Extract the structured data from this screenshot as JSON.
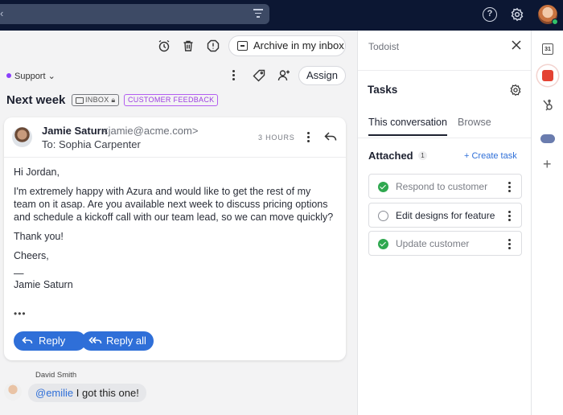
{
  "toolbar": {
    "archive_label": "Archive in my inbox"
  },
  "meta": {
    "team": "Support",
    "team_color": "#8a3ffc",
    "assign_label": "Assign"
  },
  "conversation": {
    "subject": "Next week",
    "tag_inbox": "INBOX",
    "tag_feedback": "CUSTOMER FEEDBACK"
  },
  "email": {
    "sender_name": "Jamie Saturn",
    "sender_email": "<jamie@acme.com>",
    "to_line": "To: Sophia Carpenter",
    "time": "3 HOURS",
    "greeting": "Hi Jordan,",
    "body": "I'm extremely happy with Azura and would like to get the rest of my team on it asap. Are you available next week to discuss pricing options and schedule a kickoff call with our team lead, so we can move quickly?",
    "thanks": "Thank you!",
    "closing": "Cheers,",
    "sig_dash": "—",
    "signature": "Jamie Saturn",
    "more": "•••",
    "reply_label": "Reply",
    "reply_all_label": "Reply all"
  },
  "comment": {
    "author": "David Smith",
    "mention": "@emilie",
    "text": " I got this one!"
  },
  "panel": {
    "title": "Todoist",
    "tasks_title": "Tasks",
    "tab_conversation": "This conversation",
    "tab_browse": "Browse",
    "attached_label": "Attached",
    "attached_count": "1",
    "create_task": "+ Create task",
    "tasks": [
      {
        "label": "Respond to customer",
        "done": true
      },
      {
        "label": "Edit designs for feature",
        "done": false
      },
      {
        "label": "Update customer",
        "done": true
      }
    ]
  },
  "rail": {
    "calendar_day": "31"
  },
  "colors": {
    "topbar": "#0c1733",
    "accent": "#2f6fd8",
    "done_green": "#2fa84f",
    "todoist_red": "#e44232"
  }
}
